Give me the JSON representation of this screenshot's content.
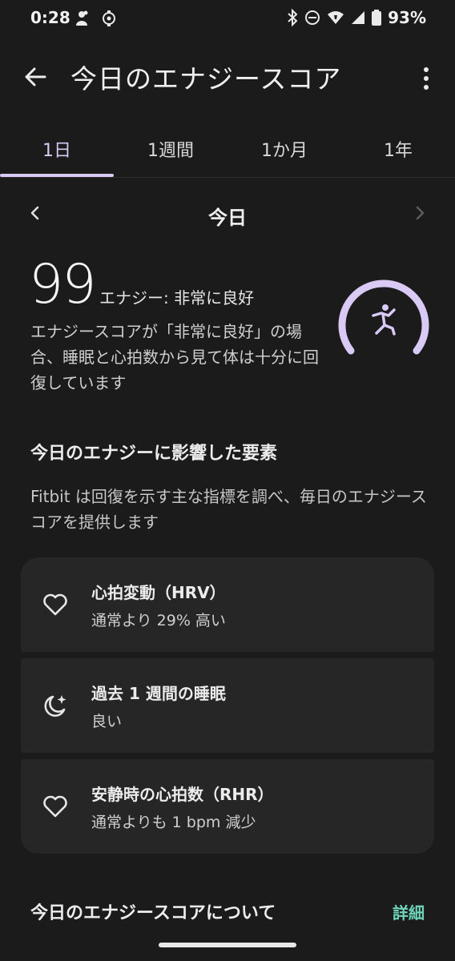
{
  "status_bar": {
    "time": "0:28",
    "battery": "93%"
  },
  "header": {
    "title": "今日のエナジースコア"
  },
  "tabs": [
    {
      "label": "1日"
    },
    {
      "label": "1週間"
    },
    {
      "label": "1か月"
    },
    {
      "label": "1年"
    }
  ],
  "active_tab": 0,
  "date_nav": {
    "label": "今日"
  },
  "score": {
    "value": "99",
    "label": "エナジー: 非常に良好",
    "description": "エナジースコアが「非常に良好」の場合、睡眠と心拍数から見て体は十分に回復しています",
    "gauge_fraction": 0.99
  },
  "factors": {
    "heading": "今日のエナジーに影響した要素",
    "description": "Fitbit は回復を示す主な指標を調べ、毎日のエナジースコアを提供します",
    "items": [
      {
        "icon": "heart-icon",
        "title": "心拍変動（HRV）",
        "subtitle": "通常より 29% 高い"
      },
      {
        "icon": "moon-sparkle-icon",
        "title": "過去 1 週間の睡眠",
        "subtitle": "良い"
      },
      {
        "icon": "heart-icon",
        "title": "安静時の心拍数（RHR）",
        "subtitle": "通常よりも 1 bpm 減少"
      }
    ]
  },
  "about": {
    "title": "今日のエナジースコアについて",
    "link": "詳細"
  },
  "colors": {
    "background": "#1b1b1b",
    "accent": "#d8c9f5",
    "card": "#262626",
    "link": "#6fd4b9"
  }
}
